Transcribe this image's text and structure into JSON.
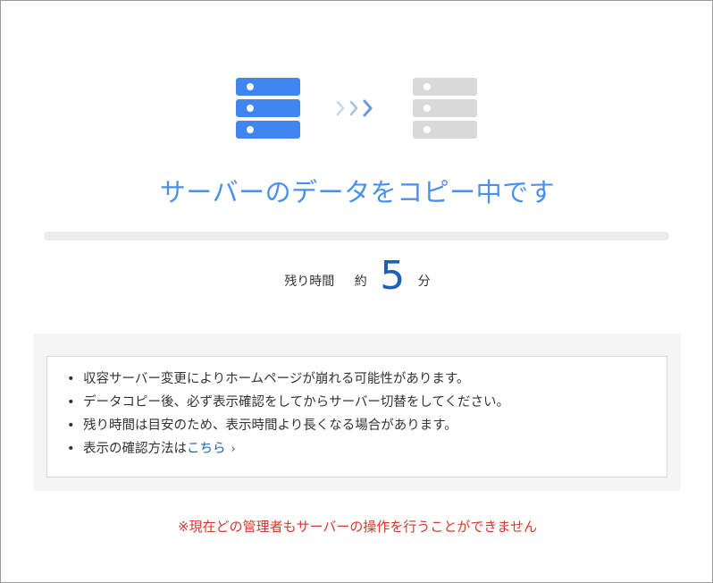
{
  "icons": {
    "source_server": "server-stack-icon",
    "transfer_arrows": "chevrons-right-icon",
    "destination_server": "server-stack-icon"
  },
  "colors": {
    "accent": "#4a8fea",
    "number": "#1e5fb8",
    "source_server": "#3f86f0",
    "destination_server": "#d9d9d9",
    "warning": "#d2392c"
  },
  "title": "サーバーのデータをコピー中です",
  "progress": {
    "percent": 0
  },
  "remaining": {
    "label": "残り時間",
    "approx": "約",
    "value": "5",
    "unit": "分"
  },
  "notices": {
    "items": [
      "収容サーバー変更によりホームページが崩れる可能性があります。",
      "データコピー後、必ず表示確認をしてからサーバー切替をしてください。",
      "残り時間は目安のため、表示時間より長くなる場合があります。"
    ],
    "last_prefix": "表示の確認方法は",
    "link_label": "こちら",
    "link_chevron": "›"
  },
  "warning": "※現在どの管理者もサーバーの操作を行うことができません"
}
